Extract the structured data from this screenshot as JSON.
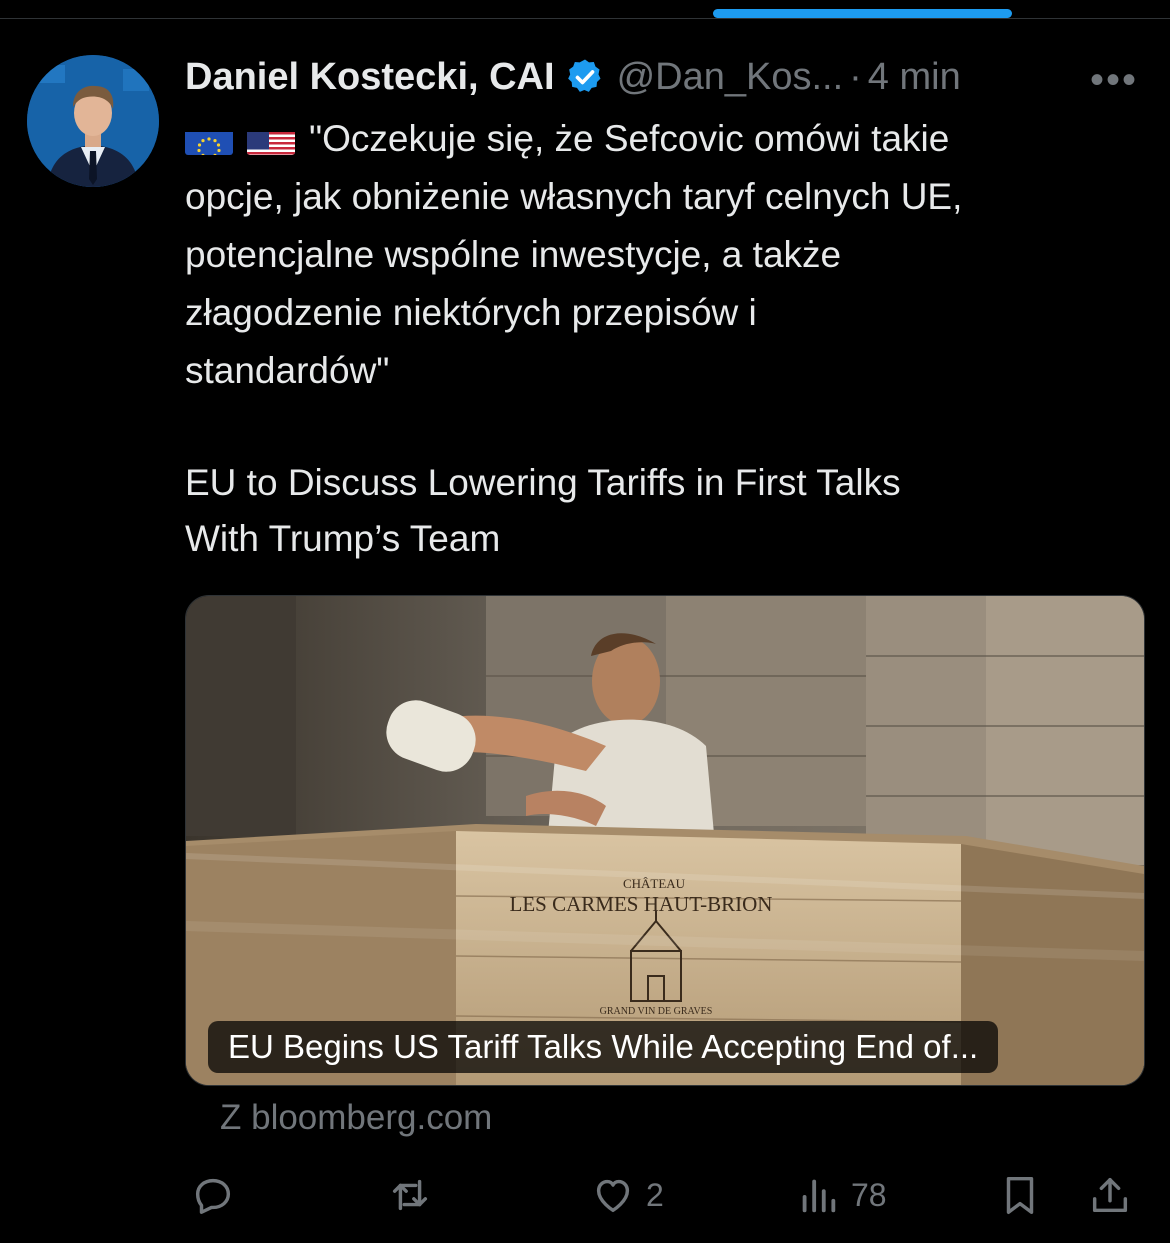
{
  "author": {
    "name": "Daniel Kostecki, CAI",
    "handle": "@Dan_Kos...",
    "separator": "·",
    "time": "4 min"
  },
  "tweet": {
    "flags": [
      "eu-flag",
      "us-flag"
    ],
    "text_lines": [
      "\"Oczekuje się, że Sefcovic omówi takie",
      "opcje, jak obniżenie własnych taryf celnych UE,",
      "potencjalne wspólne inwestycje, a także",
      "złagodzenie niektórych przepisów i",
      "standardów\""
    ],
    "headline_lines": [
      "EU to Discuss Lowering Tariffs in First Talks",
      "With Trump’s Team"
    ]
  },
  "card": {
    "caption": "EU Begins US Tariff Talks While Accepting End of...",
    "crate_text_top": "CHÂTEAU",
    "crate_text_main": "LES CARMES HAUT-BRION",
    "crate_text_bottom": "GRAND VIN DE GRAVES",
    "source": "Z bloomberg.com"
  },
  "actions": {
    "reply_count": "",
    "retweet_count": "",
    "like_count": "2",
    "views_count": "78"
  },
  "colors": {
    "background": "#000000",
    "text": "#e7e9ea",
    "muted": "#71767b",
    "accent": "#1d9bf0"
  },
  "icons": [
    "verified-badge-icon",
    "more-icon",
    "reply-icon",
    "retweet-icon",
    "like-icon",
    "views-icon",
    "bookmark-icon",
    "share-icon"
  ]
}
